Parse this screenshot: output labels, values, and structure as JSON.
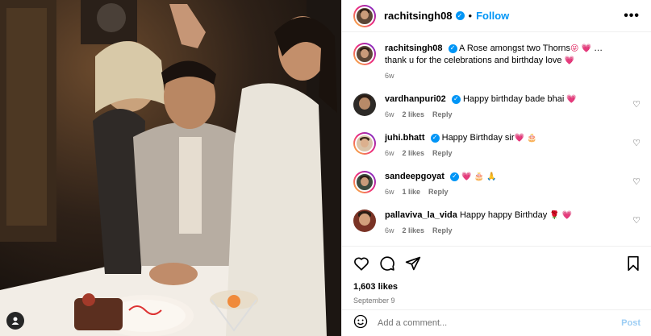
{
  "header": {
    "username": "rachitsingh08",
    "separator": "•",
    "follow_label": "Follow",
    "more_label": "•••"
  },
  "caption": {
    "username": "rachitsingh08",
    "text": "A Rose amongst two Thorns",
    "emoji": "😝 💗",
    "text2": " … thank u for the celebrations and birthday love ",
    "emoji2": "💗",
    "time": "6w"
  },
  "comments": [
    {
      "username": "vardhanpuri02",
      "verified": true,
      "text": "Happy birthday bade bhai ",
      "emoji": "💗",
      "time": "6w",
      "likes": "2 likes",
      "reply": "Reply"
    },
    {
      "username": "juhi.bhatt",
      "verified": true,
      "text": "Happy Birthday sir",
      "emoji": "💗 🎂",
      "time": "6w",
      "likes": "2 likes",
      "reply": "Reply"
    },
    {
      "username": "sandeepgoyat",
      "verified": true,
      "text": "",
      "emoji": "💗 🎂 🙏",
      "time": "6w",
      "likes": "1 like",
      "reply": "Reply"
    },
    {
      "username": "pallaviva_la_vida",
      "verified": false,
      "text": "Happy happy Birthday ",
      "emoji": "🌹 💗",
      "time": "6w",
      "likes": "2 likes",
      "reply": "Reply"
    }
  ],
  "stats": {
    "likes": "1,603 likes",
    "date": "September 9"
  },
  "composer": {
    "placeholder": "Add a comment...",
    "post_label": "Post"
  },
  "colors": {
    "accent": "#0095f6",
    "heart": "#e0245e",
    "muted": "#737373"
  },
  "icons": [
    "heart-icon",
    "comment-icon",
    "share-icon",
    "bookmark-icon",
    "emoji-icon",
    "tag-user-icon",
    "more-icon",
    "verified-icon"
  ]
}
